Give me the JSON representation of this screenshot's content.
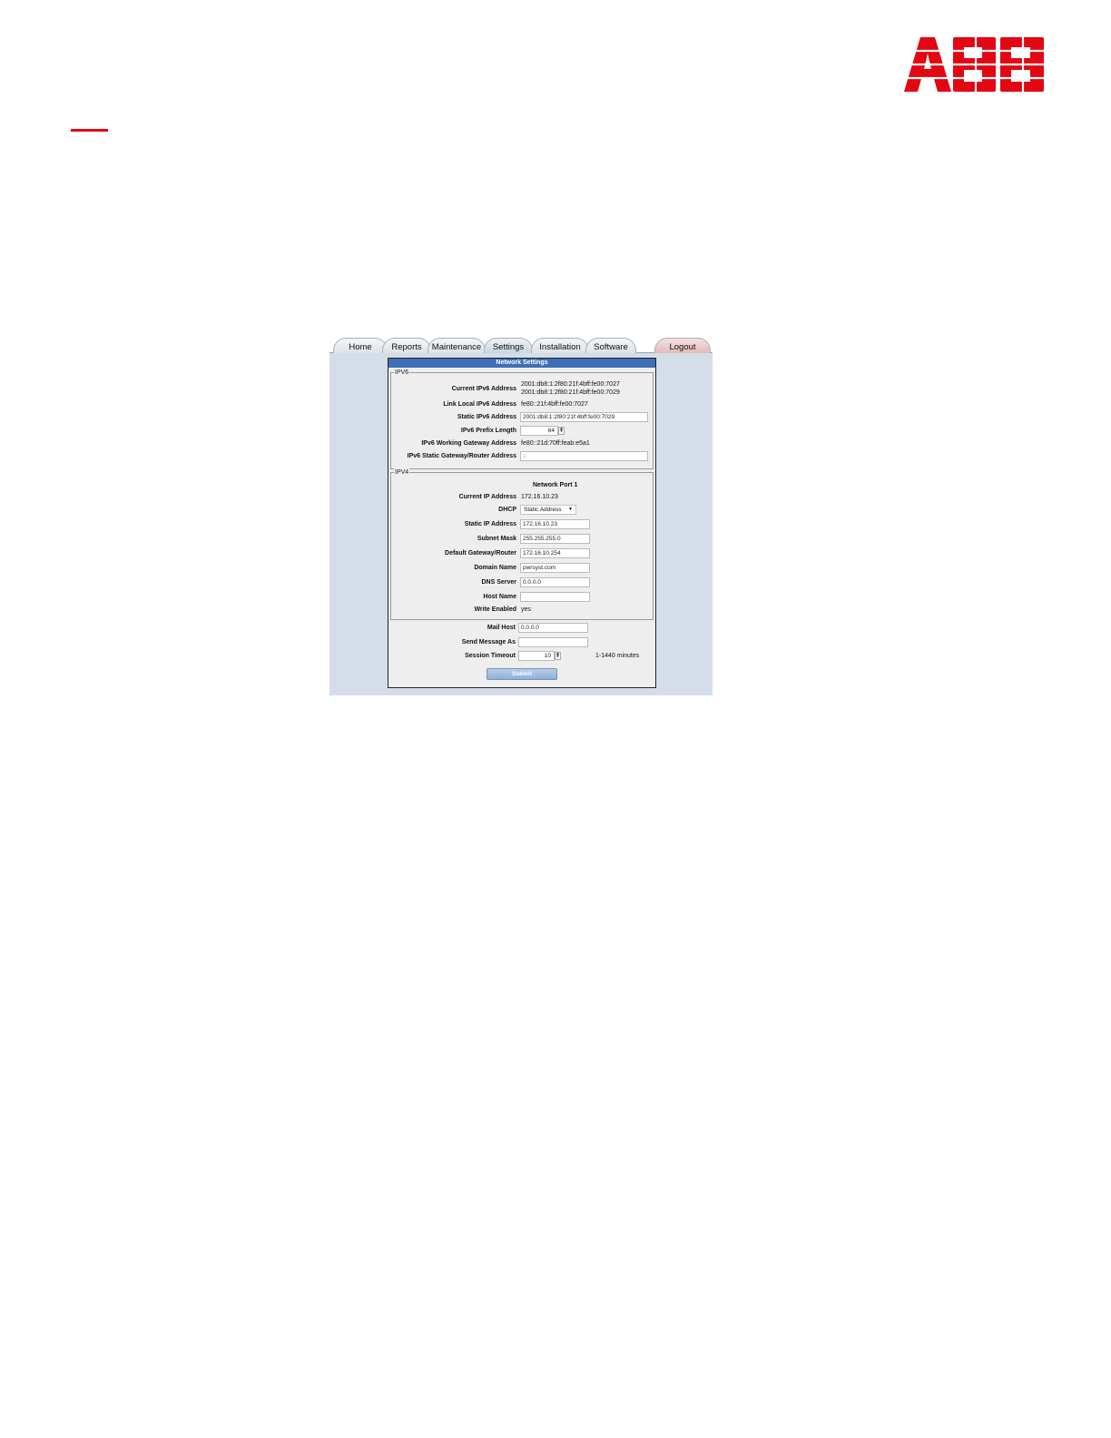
{
  "brand": {
    "logo_text": "ABB",
    "color": "#e30613"
  },
  "tabs": [
    {
      "label": "Home"
    },
    {
      "label": "Reports"
    },
    {
      "label": "Maintenance"
    },
    {
      "label": "Settings"
    },
    {
      "label": "Installation"
    },
    {
      "label": "Software"
    },
    {
      "label": "Logout"
    }
  ],
  "form": {
    "title": "Network Settings",
    "ipv6": {
      "legend": "IPV6",
      "current_label": "Current IPv6 Address",
      "current_line1": "2001:db8:1:2f80:21f:4bff:fe00:7027",
      "current_line2": "2001:db8:1:2f80:21f:4bff:fe00:7029",
      "link_local_label": "Link Local IPv6 Address",
      "link_local_value": "fe80::21f:4bff:fe00:7027",
      "static_label": "Static IPv6 Address",
      "static_value": "2001:db8:1:2f80:21f:4bff:fe00:7029",
      "prefix_label": "IPv6 Prefix Length",
      "prefix_value": "64",
      "working_gw_label": "IPv6 Working Gateway Address",
      "working_gw_value": "fe80::21d:70ff:feab:e5a1",
      "static_gw_label": "IPv6 Static Gateway/Router Address",
      "static_gw_value": "::"
    },
    "ipv4": {
      "legend": "IPV4",
      "port_heading": "Network Port 1",
      "current_ip_label": "Current IP Address",
      "current_ip_value": "172.16.10.23",
      "dhcp_label": "DHCP",
      "dhcp_value": "Static Address",
      "static_ip_label": "Static IP Address",
      "static_ip_value": "172.16.10.23",
      "subnet_label": "Subnet Mask",
      "subnet_value": "255.255.255.0",
      "gateway_label": "Default Gateway/Router",
      "gateway_value": "172.16.10.254",
      "domain_label": "Domain Name",
      "domain_value": "pwrsyst.com",
      "dns_label": "DNS Server",
      "dns_value": "0.0.0.0",
      "host_label": "Host Name",
      "host_value": "",
      "write_label": "Write Enabled",
      "write_value": "yes"
    },
    "mail_host_label": "Mail Host",
    "mail_host_value": "0.0.0.0",
    "send_as_label": "Send Message As",
    "send_as_value": "",
    "timeout_label": "Session Timeout",
    "timeout_value": "10",
    "timeout_hint": "1-1440 minutes",
    "submit_label": "Submit"
  }
}
